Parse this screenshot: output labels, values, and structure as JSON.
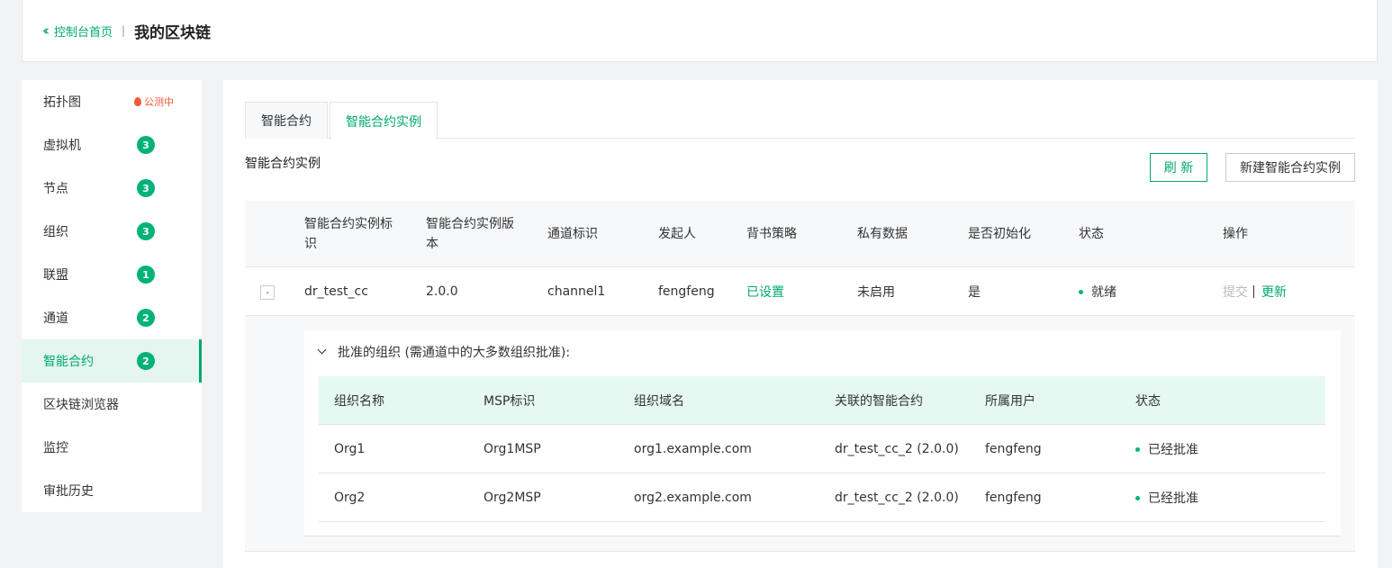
{
  "header": {
    "back_label": "控制台首页",
    "title": "我的区块链"
  },
  "sidebar": {
    "items": [
      {
        "label": "拓扑图",
        "badge": "公测中"
      },
      {
        "label": "虚拟机",
        "count": "3"
      },
      {
        "label": "节点",
        "count": "3"
      },
      {
        "label": "组织",
        "count": "3"
      },
      {
        "label": "联盟",
        "count": "1"
      },
      {
        "label": "通道",
        "count": "2"
      },
      {
        "label": "智能合约",
        "count": "2"
      },
      {
        "label": "区块链浏览器"
      },
      {
        "label": "监控"
      },
      {
        "label": "审批历史"
      }
    ]
  },
  "tabs": [
    {
      "label": "智能合约"
    },
    {
      "label": "智能合约实例"
    }
  ],
  "section": {
    "title": "智能合约实例",
    "refresh_label": "刷 新",
    "new_label": "新建智能合约实例"
  },
  "table": {
    "headers": [
      "智能合约实例标识",
      "智能合约实例版本",
      "通道标识",
      "发起人",
      "背书策略",
      "私有数据",
      "是否初始化",
      "状态",
      "操作"
    ],
    "rows": [
      {
        "expand": "-",
        "id": "dr_test_cc",
        "version": "2.0.0",
        "channel": "channel1",
        "initiator": "fengfeng",
        "endorsement": "已设置",
        "private_data": "未启用",
        "initialized": "是",
        "status": "就绪",
        "op_submit": "提交",
        "op_update": "更新"
      }
    ]
  },
  "approval": {
    "title": "批准的组织 (需通道中的大多数组织批准):",
    "headers": [
      "组织名称",
      "MSP标识",
      "组织域名",
      "关联的智能合约",
      "所属用户",
      "状态"
    ],
    "rows": [
      {
        "org": "Org1",
        "msp": "Org1MSP",
        "domain": "org1.example.com",
        "contract": "dr_test_cc_2 (2.0.0)",
        "user": "fengfeng",
        "status": "已经批准"
      },
      {
        "org": "Org2",
        "msp": "Org2MSP",
        "domain": "org2.example.com",
        "contract": "dr_test_cc_2 (2.0.0)",
        "user": "fengfeng",
        "status": "已经批准"
      }
    ]
  },
  "colors": {
    "accent": "#00a870",
    "badge_fire": "#f05a35"
  }
}
